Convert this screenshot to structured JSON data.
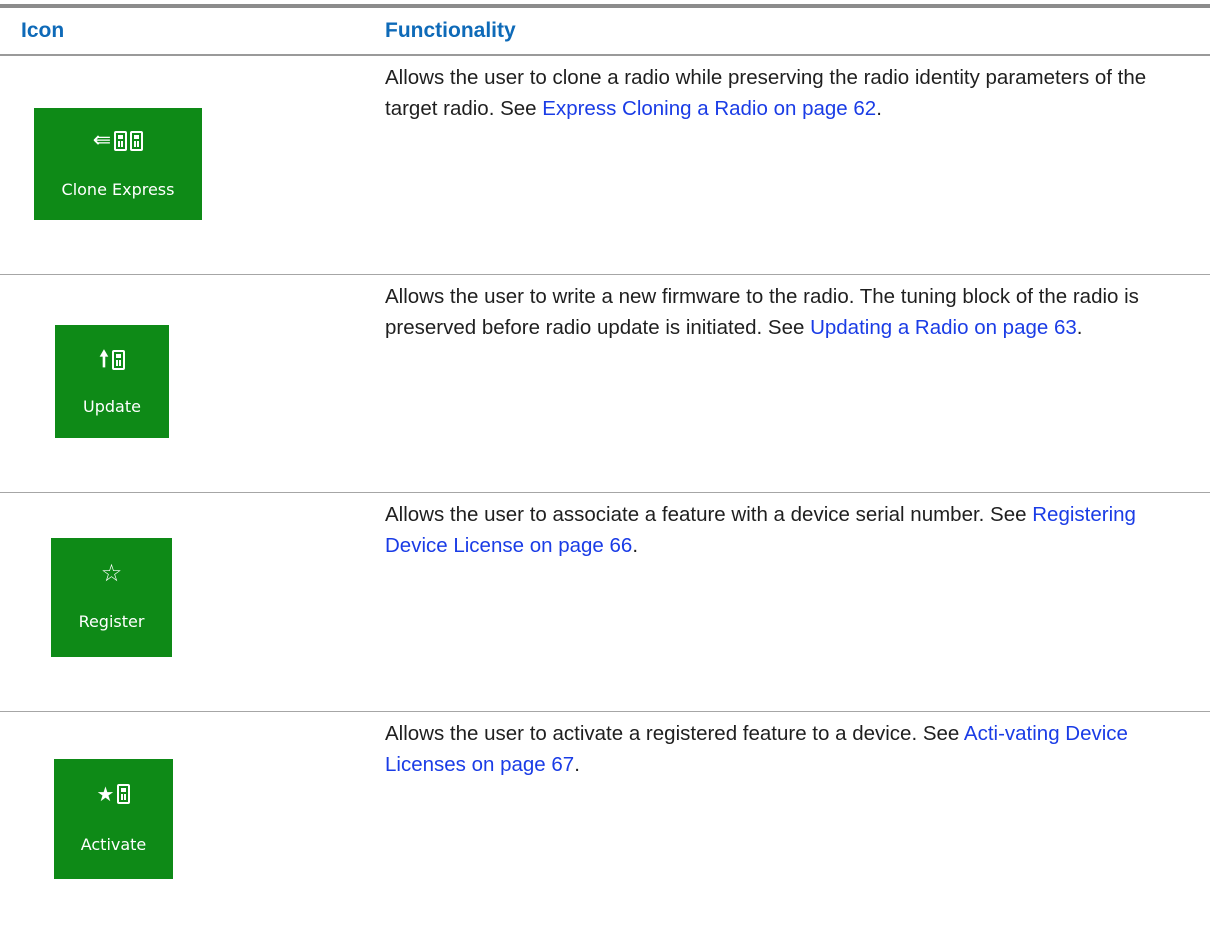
{
  "header": {
    "icon_col": "Icon",
    "func_col": "Functionality"
  },
  "rows": [
    {
      "tile_label": "Clone Express",
      "icon": "clone-express-icon",
      "text_before": "Allows the user to clone a radio while preserving the radio identity parameters of the target radio. See ",
      "link": "Express Cloning a Radio on page 62",
      "text_after": "."
    },
    {
      "tile_label": "Update",
      "icon": "update-icon",
      "text_before": "Allows the user to write a new firmware to the radio. The tuning block of the radio is preserved before radio update is initiated. See ",
      "link": "Updating a Radio on page 63",
      "text_after": "."
    },
    {
      "tile_label": "Register",
      "icon": "register-star-icon",
      "text_before": "Allows the user to associate a feature with a device serial number. See ",
      "link": "Registering Device License on page 66",
      "text_after": "."
    },
    {
      "tile_label": "Activate",
      "icon": "activate-icon",
      "text_before": "Allows the user to activate a registered feature to a device. See ",
      "link": "Acti-vating Device Licenses on page 67",
      "text_after": "."
    }
  ],
  "colors": {
    "tile_green": "#0e8a17",
    "header_blue": "#0e6ab8",
    "link_blue": "#1a3ce6"
  }
}
